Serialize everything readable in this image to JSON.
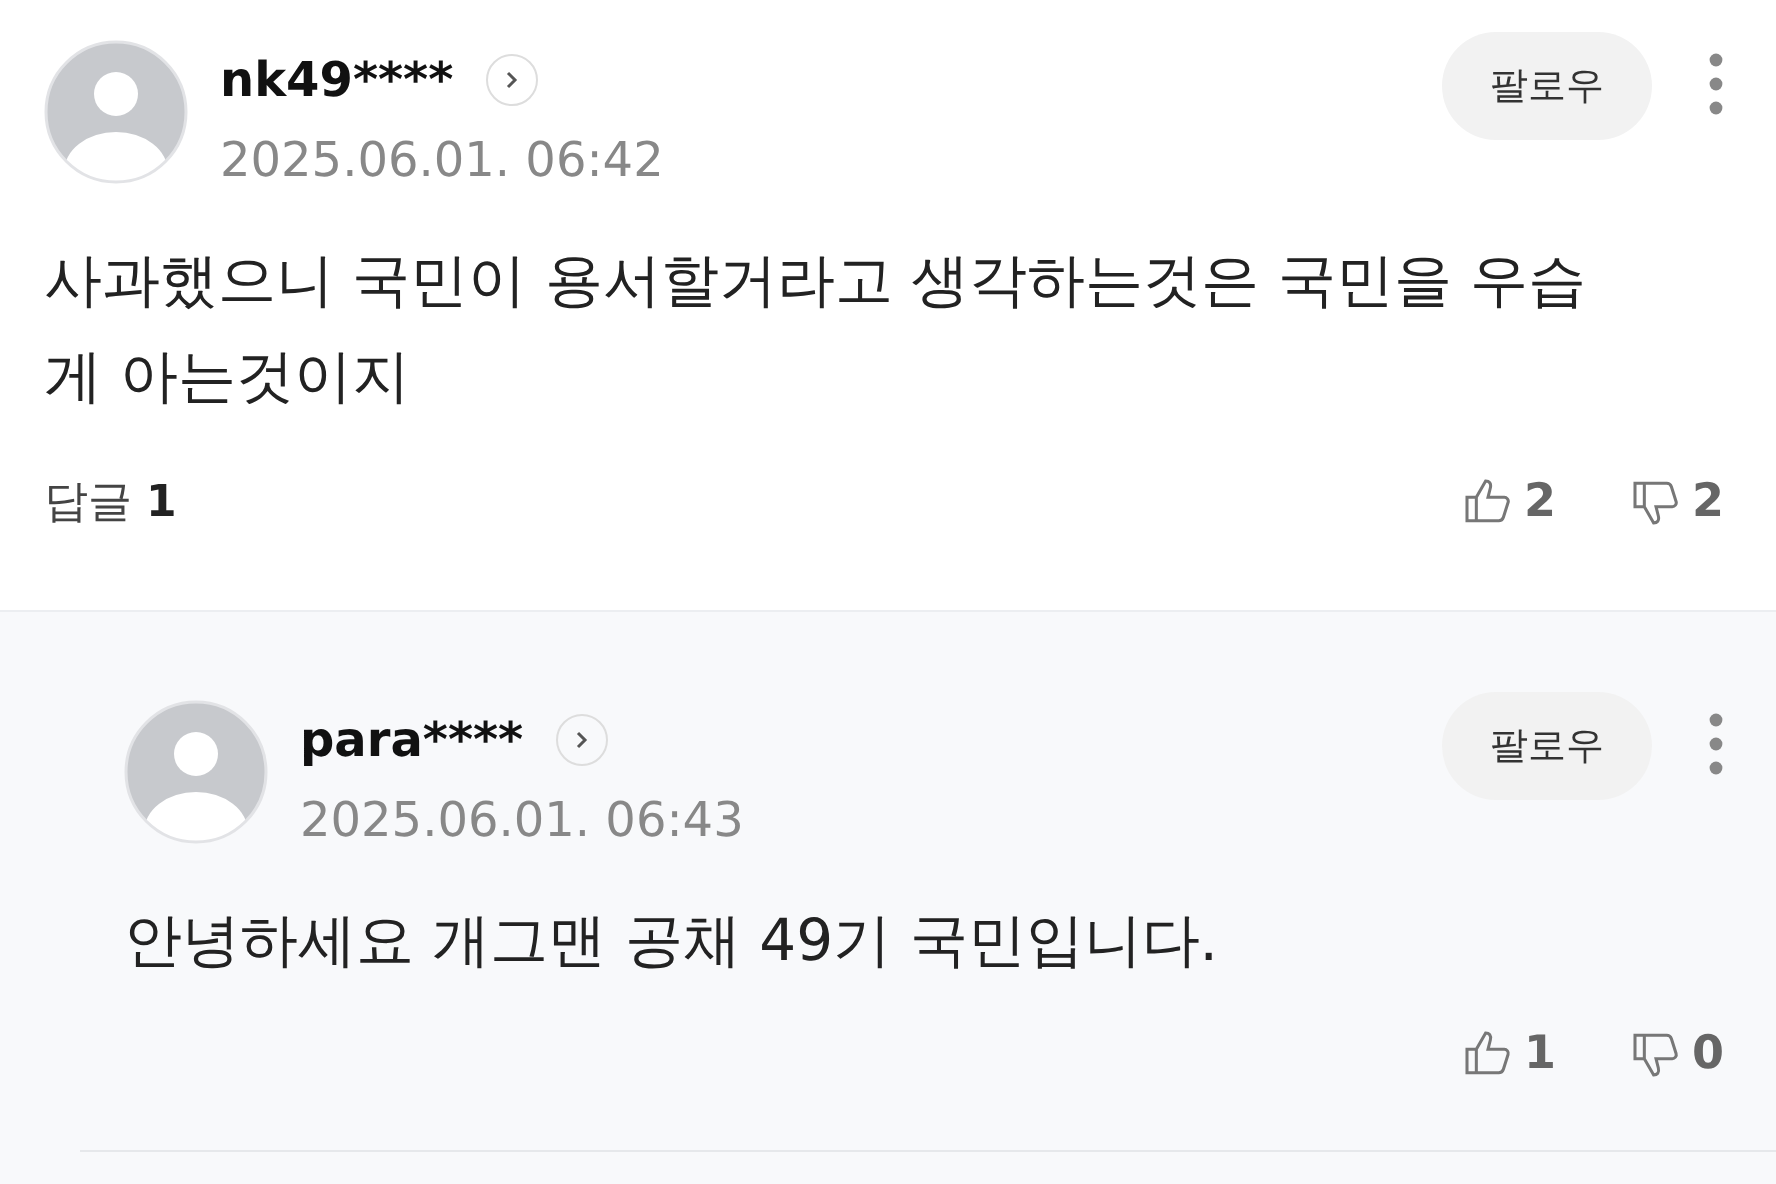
{
  "comment": {
    "author": "nk49****",
    "date": "2025.06.01. 06:42",
    "follow_label": "팔로우",
    "text": "사과했으니 국민이 용서할거라고 생각하는것은 국민을 우습게 아는것이지",
    "replies_label": "답글",
    "reply_count": "1",
    "likes": "2",
    "dislikes": "2"
  },
  "replies": [
    {
      "author": "para****",
      "date": "2025.06.01. 06:43",
      "follow_label": "팔로우",
      "text": "안녕하세요 개그맨 공채 49기 국민입니다.",
      "likes": "1",
      "dislikes": "0"
    }
  ]
}
